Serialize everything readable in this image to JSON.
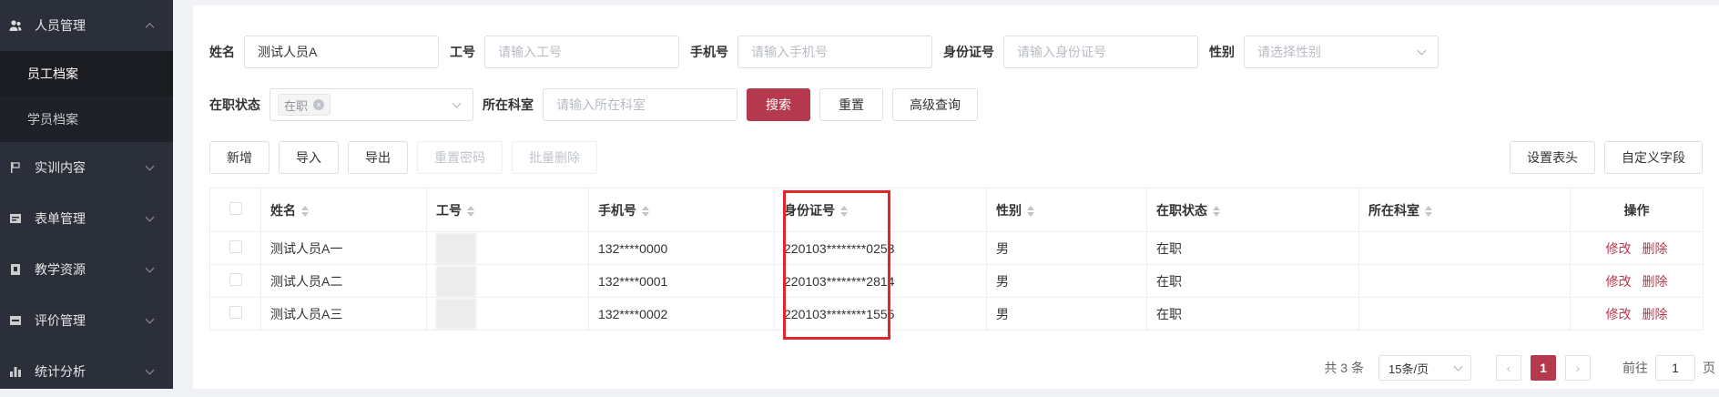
{
  "sidebar": {
    "groups": [
      {
        "label": "人员管理",
        "icon": "user-group-icon"
      },
      {
        "label": "实训内容",
        "icon": "flag-icon"
      },
      {
        "label": "表单管理",
        "icon": "form-icon"
      },
      {
        "label": "教学资源",
        "icon": "book-icon"
      },
      {
        "label": "评价管理",
        "icon": "rating-icon"
      },
      {
        "label": "统计分析",
        "icon": "bar-chart-icon"
      }
    ],
    "submenu": [
      {
        "label": "员工档案"
      },
      {
        "label": "学员档案"
      }
    ]
  },
  "filters": {
    "name_label": "姓名",
    "name_value": "测试人员A",
    "id_label": "工号",
    "id_placeholder": "请输入工号",
    "phone_label": "手机号",
    "phone_placeholder": "请输入手机号",
    "idcard_label": "身份证号",
    "idcard_placeholder": "请输入身份证号",
    "gender_label": "性别",
    "gender_placeholder": "请选择性别",
    "status_label": "在职状态",
    "status_tag": "在职",
    "dept_label": "所在科室",
    "dept_placeholder": "请输入所在科室",
    "search": "搜索",
    "reset": "重置",
    "advanced": "高级查询"
  },
  "toolbar": {
    "add": "新增",
    "import": "导入",
    "export": "导出",
    "reset_pwd": "重置密码",
    "batch_delete": "批量删除",
    "set_header": "设置表头",
    "custom_fields": "自定义字段"
  },
  "table": {
    "headers": [
      "姓名",
      "工号",
      "手机号",
      "身份证号",
      "性别",
      "在职状态",
      "所在科室",
      "操作"
    ],
    "rows": [
      {
        "name": "测试人员A一",
        "phone": "132****0000",
        "idcard": "220103********0253",
        "gender": "男",
        "status": "在职"
      },
      {
        "name": "测试人员A二",
        "phone": "132****0001",
        "idcard": "220103********2814",
        "gender": "男",
        "status": "在职"
      },
      {
        "name": "测试人员A三",
        "phone": "132****0002",
        "idcard": "220103********1555",
        "gender": "男",
        "status": "在职"
      }
    ],
    "edit": "修改",
    "delete": "删除"
  },
  "pager": {
    "total": "共 3 条",
    "page_size": "15条/页",
    "current": "1",
    "goto": "前往",
    "goto_value": "1",
    "page_unit": "页"
  }
}
